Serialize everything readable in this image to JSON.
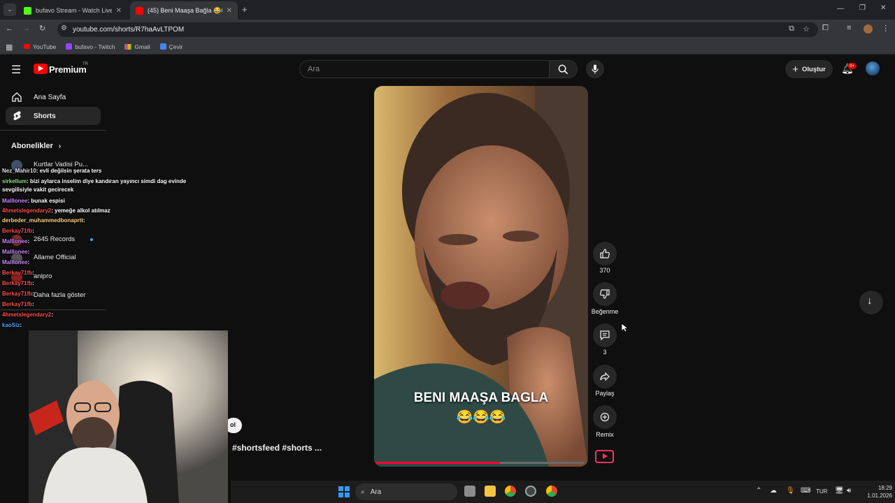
{
  "browser": {
    "tabs": [
      {
        "title": "bufavo Stream - Watch Live on",
        "active": false
      },
      {
        "title": "(45) Beni Maaşa Bağla 😂😂😂",
        "active": true
      }
    ],
    "url": "youtube.com/shorts/R7haAvLTPOM",
    "bookmarks": [
      "YouTube",
      "bufavo - Twitch",
      "Gmail",
      "Çevir"
    ]
  },
  "youtube": {
    "logo_text": "Premium",
    "logo_region": "TR",
    "search_placeholder": "Ara",
    "create_label": "Oluştur",
    "notif_badge": "9+",
    "sidebar": {
      "items": [
        {
          "label": "Ana Sayfa",
          "icon": "home-icon"
        },
        {
          "label": "Shorts",
          "icon": "shorts-icon",
          "active": true
        }
      ],
      "subscriptions_label": "Abonelikler",
      "subscriptions": [
        "Kurtlar Vadisi Pu...",
        "2645 Records",
        "Allame Official",
        "anipro",
        "Daha fazla göster"
      ]
    },
    "short": {
      "caption": "BENI MAAŞA BAGLA",
      "caption_emoji": "😂😂😂",
      "likes": "370",
      "dislike_label": "Beğenme",
      "comments": "3",
      "share_label": "Paylaş",
      "remix_label": "Remix",
      "hashtags": "#shortsfeed #shorts  ...",
      "pill_text": "ol"
    }
  },
  "chat": [
    {
      "user": "Nez_Mahir10",
      "text": ": evli değilsin şerata ters",
      "color": "#e0e0e0"
    },
    {
      "user": "sirkellum",
      "text": ": bizi aylarca inselim diye kandıran yayıncı simdi dag evinde",
      "color": "#8be58b"
    },
    {
      "user": "",
      "text": "sevgilisiyle vakit gecirecek",
      "color": "#ffffff"
    },
    {
      "user": "Malllonee",
      "text": ": bunak espisi",
      "color": "#c884ff"
    },
    {
      "user": "4hmetslegendary2",
      "text": ": yemeğe alkol atılmaz",
      "color": "#ff4d4d"
    },
    {
      "user": "derbeder_muhammedbonaprtt",
      "text": ":",
      "color": "#ffd27f"
    },
    {
      "user": "Berkay71fb",
      "text": ":",
      "color": "#ff4d4d"
    },
    {
      "user": "Malllonee",
      "text": ":",
      "color": "#c884ff"
    },
    {
      "user": "Malllonee",
      "text": ":",
      "color": "#c884ff"
    },
    {
      "user": "Malllonee",
      "text": ":",
      "color": "#c884ff"
    },
    {
      "user": "Berkay71fb",
      "text": ":",
      "color": "#ff4d4d"
    },
    {
      "user": "Berkay71fb",
      "text": ":",
      "color": "#ff4d4d"
    },
    {
      "user": "Berkay71fb",
      "text": ":",
      "color": "#ff4d4d"
    },
    {
      "user": "Berkay71fb",
      "text": ":",
      "color": "#ff4d4d"
    },
    {
      "user": "4hmetslegendary2",
      "text": ":",
      "color": "#ff4d4d"
    },
    {
      "user": "kaoSiz",
      "text": ":",
      "color": "#4da6ff"
    }
  ],
  "taskbar": {
    "search_label": "Ara",
    "language": "TUR",
    "time": "18:29",
    "date": "1.01.2026"
  }
}
